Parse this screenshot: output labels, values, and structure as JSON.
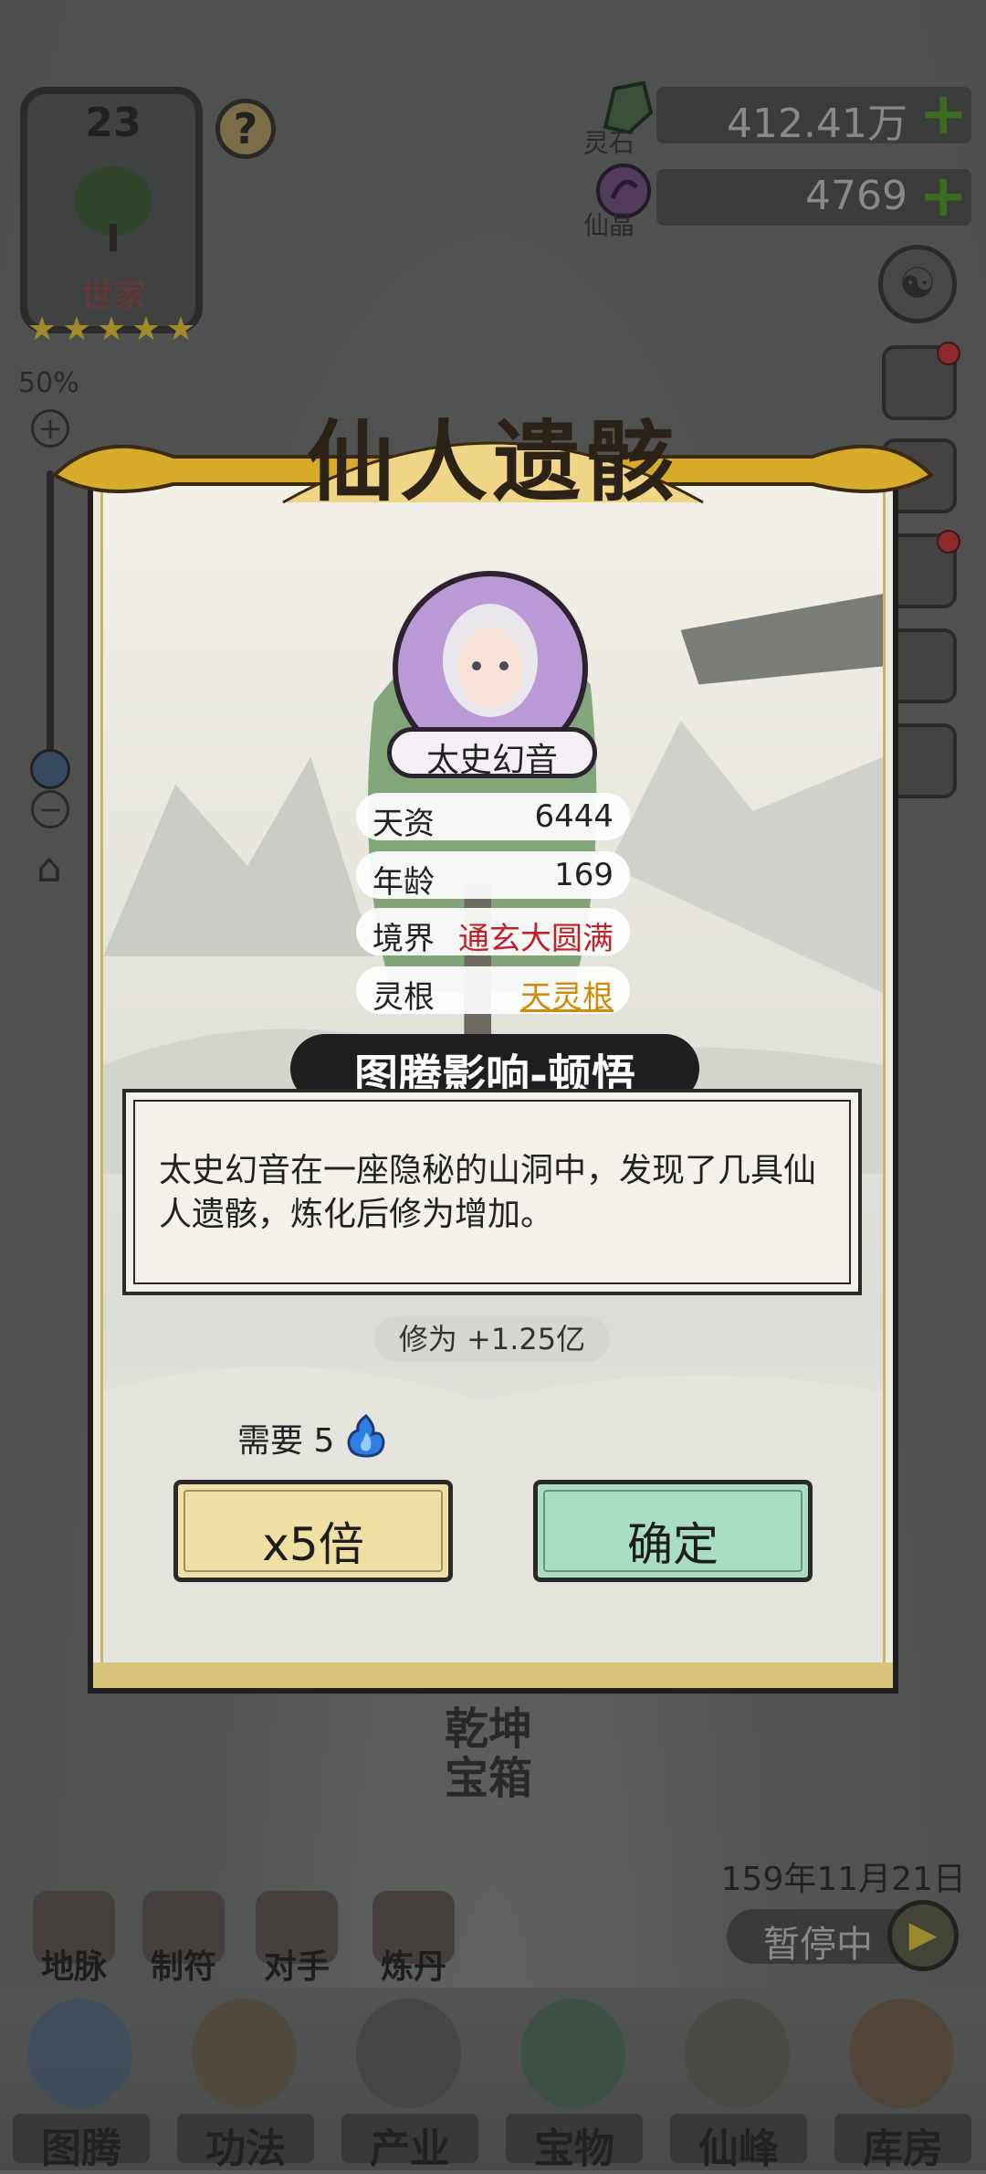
{
  "crest": {
    "level": "23",
    "label": "世家",
    "stars": 5
  },
  "zoom": {
    "percent": "50%"
  },
  "currencies": [
    {
      "label": "灵石",
      "value": "412.41万",
      "icon": "spirit-stone-icon"
    },
    {
      "label": "仙晶",
      "value": "4769",
      "icon": "immortal-crystal-icon"
    }
  ],
  "chest": {
    "line1": "乾坤",
    "line2": "宝箱"
  },
  "mini_nav": [
    "地脉",
    "制符",
    "对手",
    "炼丹"
  ],
  "date": "159年11月21日",
  "pause_label": "暂停中",
  "tabs": [
    "图腾",
    "功法",
    "产业",
    "宝物",
    "仙峰",
    "库房"
  ],
  "modal": {
    "title": "仙人遗骸",
    "character": {
      "name": "太史幻音",
      "stats": [
        {
          "key": "天资",
          "value": "6444"
        },
        {
          "key": "年龄",
          "value": "169"
        },
        {
          "key": "境界",
          "value": "通玄大圆满"
        },
        {
          "key": "灵根",
          "value": "天灵根"
        }
      ]
    },
    "event_title": "图腾影响-顿悟",
    "description": "太史幻音在一座隐秘的山洞中，发现了几具仙人遗骸，炼化后修为增加。",
    "reward": "修为 +1.25亿",
    "cost_label": "需要 5",
    "cost_icon": "blue-flame-icon",
    "buttons": {
      "multiply": "x5倍",
      "confirm": "确定"
    }
  },
  "colors": {
    "realm_red": "#c0202a",
    "root_gold": "#d08a10",
    "confirm_green": "#a8ddc4",
    "multiply_yellow": "#f0dfa2",
    "avatar_purple": "#b99ad6"
  }
}
